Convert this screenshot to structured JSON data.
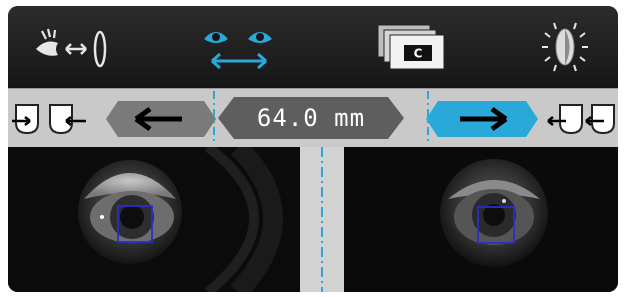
{
  "toolbar": {
    "icons": [
      "eye-lens-distance-icon",
      "binocular-pd-icon",
      "card-stack-c-icon",
      "lens-light-icon"
    ],
    "card_letter": "C",
    "active_color": "#29a9d8"
  },
  "pd_bar": {
    "value": "64.0 mm",
    "selected_side": "right",
    "active_color": "#29a9d8",
    "inactive_color": "#7a7a7a"
  },
  "views": {
    "left_eye": {
      "marker_color": "#2b2bd1"
    },
    "right_eye": {
      "marker_color": "#2b2bd1"
    }
  }
}
